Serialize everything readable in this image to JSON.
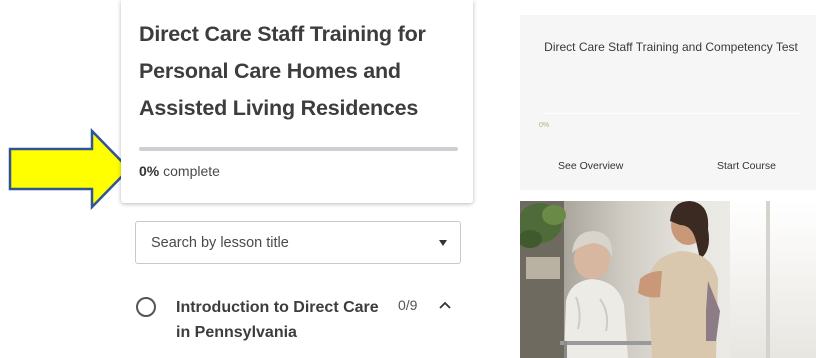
{
  "course": {
    "title": "Direct Care Staff Training for Personal Care Homes and Assisted Living Residences",
    "progress_value": "0%",
    "progress_suffix": " complete",
    "progress_fraction": 0
  },
  "search": {
    "placeholder": "Search by lesson title"
  },
  "lessons": [
    {
      "title": "Introduction to Direct Care in Pennsylvania",
      "count": "0/9",
      "expanded": true
    }
  ],
  "right_card": {
    "title": "Direct Care Staff Training and Competency Test",
    "progress_label": "0%",
    "see_overview": "See Overview",
    "start_course": "Start Course"
  },
  "colors": {
    "arrow_fill": "#ffff00",
    "arrow_stroke": "#2f5597",
    "right_progress_text": "#9ebd73"
  },
  "icons": {
    "arrow": "right-arrow-icon",
    "dropdown": "caret-down-icon",
    "lesson_status": "circle-icon",
    "collapse": "chevron-up-icon"
  }
}
